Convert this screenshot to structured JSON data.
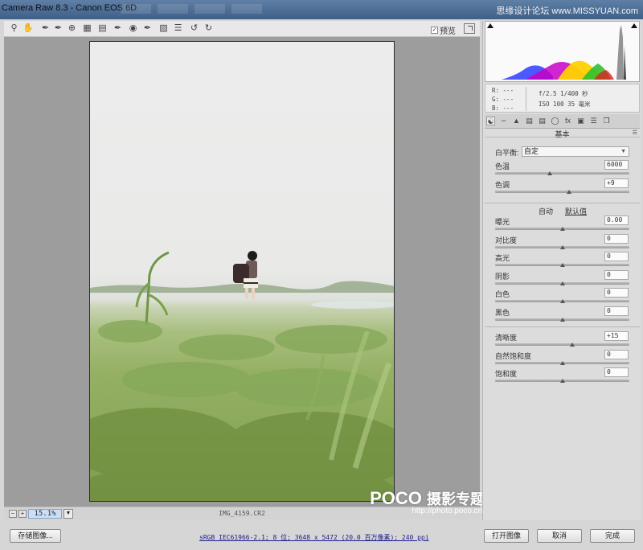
{
  "window": {
    "title": "Camera Raw 8.3 -  Canon EOS 6D",
    "watermark_top": "思缘设计论坛 www.MISSYUAN.com"
  },
  "toolbar": {
    "preview_label": "预览",
    "preview_checked": true
  },
  "image": {
    "filename": "IMG_4159.CR2",
    "zoom": "15.1%"
  },
  "watermark": {
    "brand": "POCO",
    "subtitle": "摄影专题",
    "url": "http://photo.poco.cn/"
  },
  "info": {
    "r": "R:  ---",
    "g": "G:  ---",
    "b": "B:  ---",
    "aperture_shutter": "f/2.5  1/400 秒",
    "iso_focal": "ISO 100  35 毫米"
  },
  "panel": {
    "title": "基本",
    "white_balance_label": "白平衡:",
    "white_balance_value": "自定",
    "auto_label": "自动",
    "default_label": "默认值",
    "sliders": [
      {
        "label": "色温",
        "value": "6000",
        "pos": 0.41
      },
      {
        "label": "色调",
        "value": "+9",
        "pos": 0.55
      },
      {
        "label": "曝光",
        "value": "0.00",
        "pos": 0.5
      },
      {
        "label": "对比度",
        "value": "0",
        "pos": 0.5
      },
      {
        "label": "高光",
        "value": "0",
        "pos": 0.5
      },
      {
        "label": "阴影",
        "value": "0",
        "pos": 0.5
      },
      {
        "label": "白色",
        "value": "0",
        "pos": 0.5
      },
      {
        "label": "黑色",
        "value": "0",
        "pos": 0.5
      },
      {
        "label": "清晰度",
        "value": "+15",
        "pos": 0.575
      },
      {
        "label": "自然饱和度",
        "value": "0",
        "pos": 0.5
      },
      {
        "label": "饱和度",
        "value": "0",
        "pos": 0.5
      }
    ]
  },
  "bottom": {
    "save_label": "存储图像...",
    "workflow_link": "sRGB IEC61966-2.1; 8 位; 3648 x 5472 (20.0 百万像素); 240 ppi",
    "open_label": "打开图像",
    "cancel_label": "取消",
    "done_label": "完成"
  },
  "colors": {
    "zoom_bg": "#ccdff5",
    "canvas_bg": "#9d9d9d",
    "titlebar": "#4a6b95"
  }
}
